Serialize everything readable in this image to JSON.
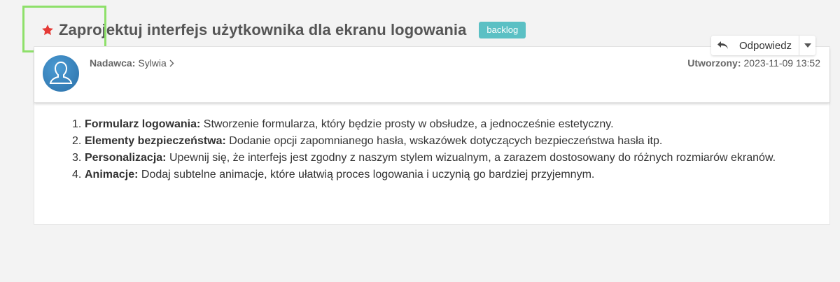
{
  "ticket": {
    "title": "Zaprojektuj interfejs użytkownika dla ekranu logowania",
    "tag": "backlog",
    "starred": true
  },
  "actions": {
    "reply_label": "Odpowiedz"
  },
  "message": {
    "sender_label": "Nadawca:",
    "sender_name": "Sylwia",
    "created_label": "Utworzony:",
    "created_value": "2023-11-09 13:52",
    "items": [
      {
        "number": "1.",
        "heading": "Formularz logowania:",
        "text": " Stworzenie formularza, który będzie prosty w obsłudze, a jednocześnie estetyczny."
      },
      {
        "number": "2.",
        "heading": "Elementy bezpieczeństwa:",
        "text": " Dodanie opcji zapomnianego hasła, wskazówek dotyczących bezpieczeństwa hasła itp."
      },
      {
        "number": "3.",
        "heading": "Personalizacja:",
        "text": " Upewnij się, że interfejs jest zgodny z naszym stylem wizualnym, a zarazem dostosowany do różnych rozmiarów ekranów."
      },
      {
        "number": "4.",
        "heading": "Animacje:",
        "text": " Dodaj subtelne animacje, które ułatwią proces logowania i uczynią go bardziej przyjemnym."
      }
    ]
  },
  "colors": {
    "star": "#e53935",
    "badge": "#5bc0c4",
    "focus_outline": "#8ee06a",
    "avatar": "#3a86c4"
  },
  "icons": {
    "star": "star-icon",
    "reply": "reply-icon",
    "caret": "chevron-down-icon",
    "sender_chevron": "chevron-right-icon",
    "avatar": "user-silhouette-icon"
  }
}
